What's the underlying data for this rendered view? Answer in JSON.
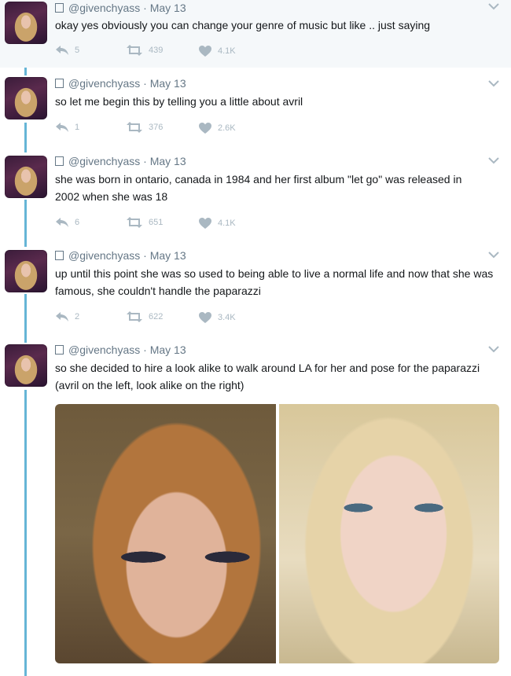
{
  "colors": {
    "thread_line": "#66b5d6",
    "meta_text": "#657786",
    "action_icon": "#aab8c2",
    "highlight_bg": "#f5f8fa"
  },
  "tweets": [
    {
      "handle": "@givenchyass",
      "date": "May 13",
      "text": "okay yes obviously you can change your genre of music but like .. just saying",
      "replies": "5",
      "retweets": "439",
      "likes": "4.1K"
    },
    {
      "handle": "@givenchyass",
      "date": "May 13",
      "text": "so let me begin this by telling you a little about avril",
      "replies": "1",
      "retweets": "376",
      "likes": "2.6K"
    },
    {
      "handle": "@givenchyass",
      "date": "May 13",
      "text": "she was born in ontario, canada in 1984 and her first album \"let go\" was released in 2002 when she was 18",
      "replies": "6",
      "retweets": "651",
      "likes": "4.1K"
    },
    {
      "handle": "@givenchyass",
      "date": "May 13",
      "text": "up until this point she was so used to being able to live a normal life and now that she was famous, she couldn't handle the paparazzi",
      "replies": "2",
      "retweets": "622",
      "likes": "3.4K"
    },
    {
      "handle": "@givenchyass",
      "date": "May 13",
      "text": "so she decided to hire a look alike to walk around LA for her and pose for the paparazzi (avril on the left, look alike on the right)"
    }
  ],
  "icons": {
    "reply": "reply-icon",
    "retweet": "retweet-icon",
    "like": "heart-icon",
    "menu": "chevron-down-icon",
    "unknown_glyph": "missing-glyph-box"
  },
  "separator": " · "
}
